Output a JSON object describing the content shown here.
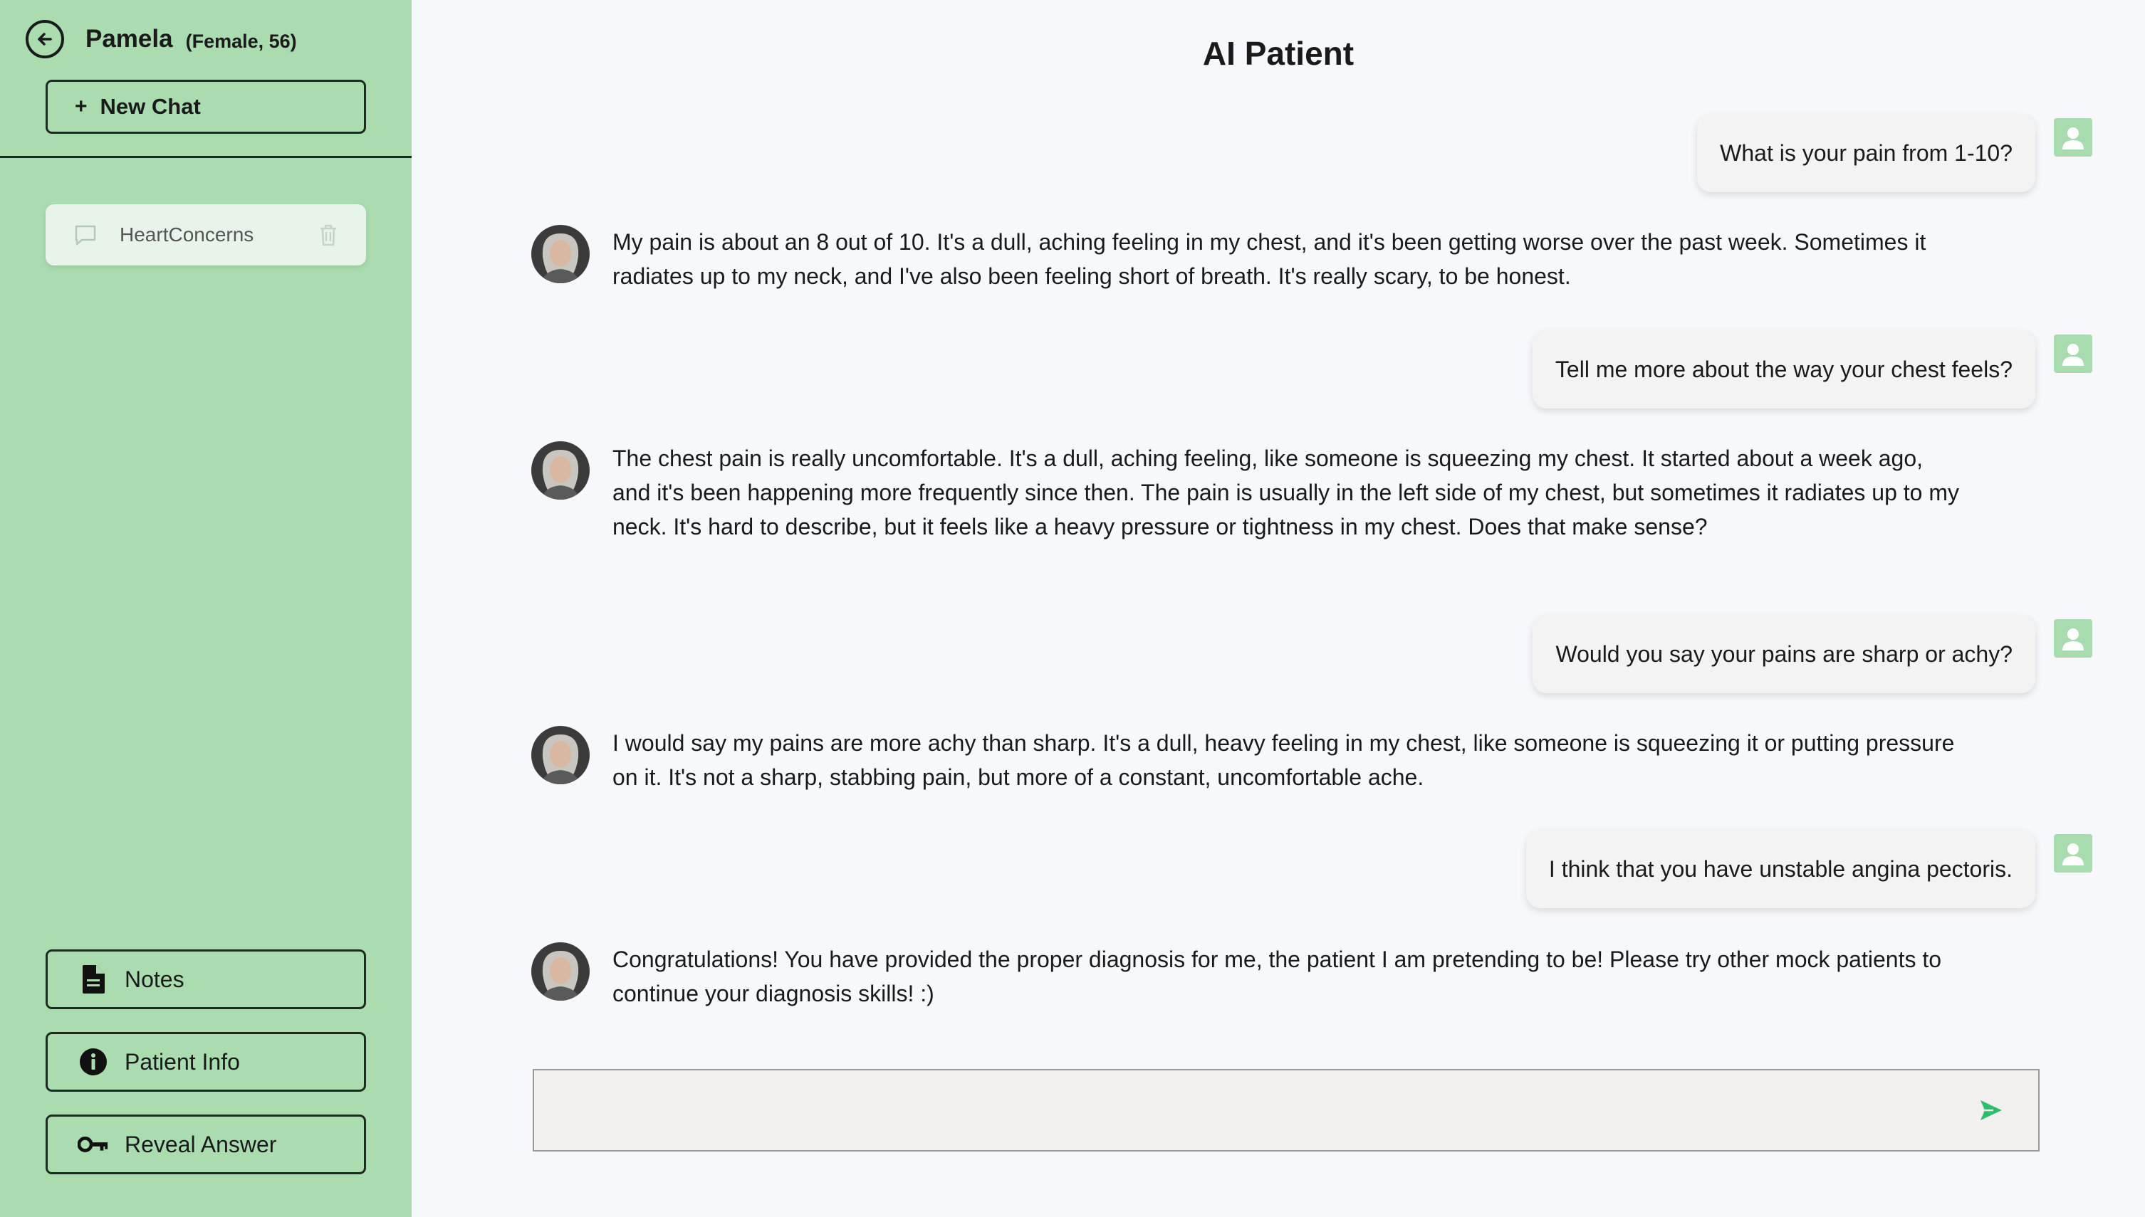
{
  "sidebar": {
    "patient_name": "Pamela",
    "patient_meta": "(Female, 56)",
    "new_chat_label": "New Chat",
    "new_chat_plus": "+",
    "chats": [
      {
        "label": "HeartConcerns"
      }
    ],
    "buttons": {
      "notes": "Notes",
      "patient_info": "Patient Info",
      "reveal_answer": "Reveal Answer"
    }
  },
  "main": {
    "title": "AI Patient",
    "messages": [
      {
        "role": "user",
        "text": "What is your pain from 1-10?"
      },
      {
        "role": "ai",
        "text": "My pain is about an 8 out of 10. It's a dull, aching feeling in my chest, and it's been getting worse over the past week. Sometimes it radiates up to my neck, and I've also been feeling short of breath. It's really scary, to be honest."
      },
      {
        "role": "user",
        "text": "Tell me more about the way your chest feels?"
      },
      {
        "role": "ai",
        "text": "The chest pain is really uncomfortable. It's a dull, aching feeling, like someone is squeezing my chest. It started about a week ago, and it's been happening more frequently since then. The pain is usually in the left side of my chest, but sometimes it radiates up to my neck. It's hard to describe, but it feels like a heavy pressure or tightness in my chest. Does that make sense?"
      },
      {
        "role": "user",
        "text": "Would you say your pains are sharp or achy?"
      },
      {
        "role": "ai",
        "text": "I would say my pains are more achy than sharp. It's a dull, heavy feeling in my chest, like someone is squeezing it or putting pressure on it. It's not a sharp, stabbing pain, but more of a constant, uncomfortable ache."
      },
      {
        "role": "user",
        "text": "I think that you have unstable angina pectoris."
      },
      {
        "role": "ai",
        "text": "Congratulations! You have provided the proper diagnosis for me, the patient I am pretending to be! Please try other mock patients to continue your diagnosis skills! :)"
      }
    ],
    "input": {
      "value": "",
      "placeholder": ""
    }
  },
  "colors": {
    "sidebar_bg": "#abdcb0",
    "main_bg": "#f7f8fb",
    "accent": "#2dbe6c",
    "user_avatar_bg": "#a8dcaf"
  },
  "icons": {
    "back": "arrow-left-circle-icon",
    "chat": "chat-bubble-icon",
    "trash": "trash-icon",
    "notes": "document-icon",
    "info": "info-icon",
    "reveal": "key-icon",
    "user": "user-icon",
    "send": "send-icon"
  }
}
